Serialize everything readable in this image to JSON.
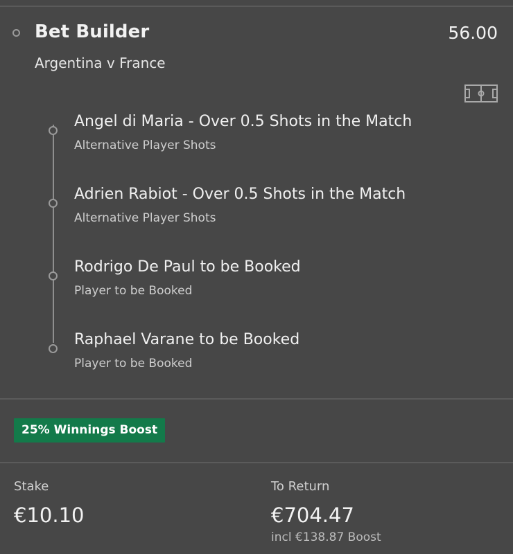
{
  "bet": {
    "title": "Bet Builder",
    "odds": "56.00",
    "match": "Argentina v France",
    "icon": "pitch-icon"
  },
  "selections": [
    {
      "title": "Angel di Maria - Over 0.5 Shots in the Match",
      "market": "Alternative Player Shots"
    },
    {
      "title": "Adrien Rabiot - Over 0.5 Shots in the Match",
      "market": "Alternative Player Shots"
    },
    {
      "title": "Rodrigo De Paul to be Booked",
      "market": "Player to be Booked"
    },
    {
      "title": "Raphael Varane to be Booked",
      "market": "Player to be Booked"
    }
  ],
  "boost": {
    "label": "25% Winnings Boost",
    "color": "#137a4a"
  },
  "totals": {
    "stake_label": "Stake",
    "stake_value": "€10.10",
    "return_label": "To Return",
    "return_value": "€704.47",
    "boost_note": "incl €138.87 Boost"
  },
  "colors": {
    "background": "#474747",
    "text": "#f2f2f2",
    "subtext": "#cfcfcf"
  }
}
